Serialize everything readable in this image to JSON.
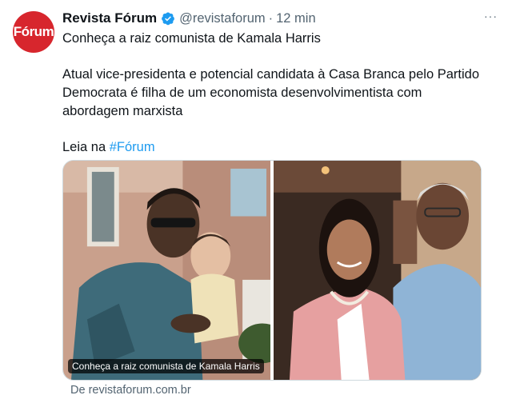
{
  "tweet": {
    "author_name": "Revista Fórum",
    "handle": "@revistaforum",
    "separator": "·",
    "time": "12 min",
    "avatar_text": "Fórum",
    "lines": [
      "Conheça a raiz comunista de Kamala Harris",
      "Atual  vice-presidenta e potencial candidata à Casa Branca pelo Partido",
      "Democrata é filha de um economista desenvolvimentista com",
      "abordagem  marxista",
      "Leia na "
    ],
    "hashtag": "#Fórum",
    "more_label": "···"
  },
  "card": {
    "caption": "Conheça a raiz comunista de Kamala Harris",
    "source": "De revistaforum.com.br"
  },
  "colors": {
    "brand": "#d7262d",
    "link": "#1d9bf0",
    "verified": "#1d9bf0",
    "muted": "#536471"
  }
}
